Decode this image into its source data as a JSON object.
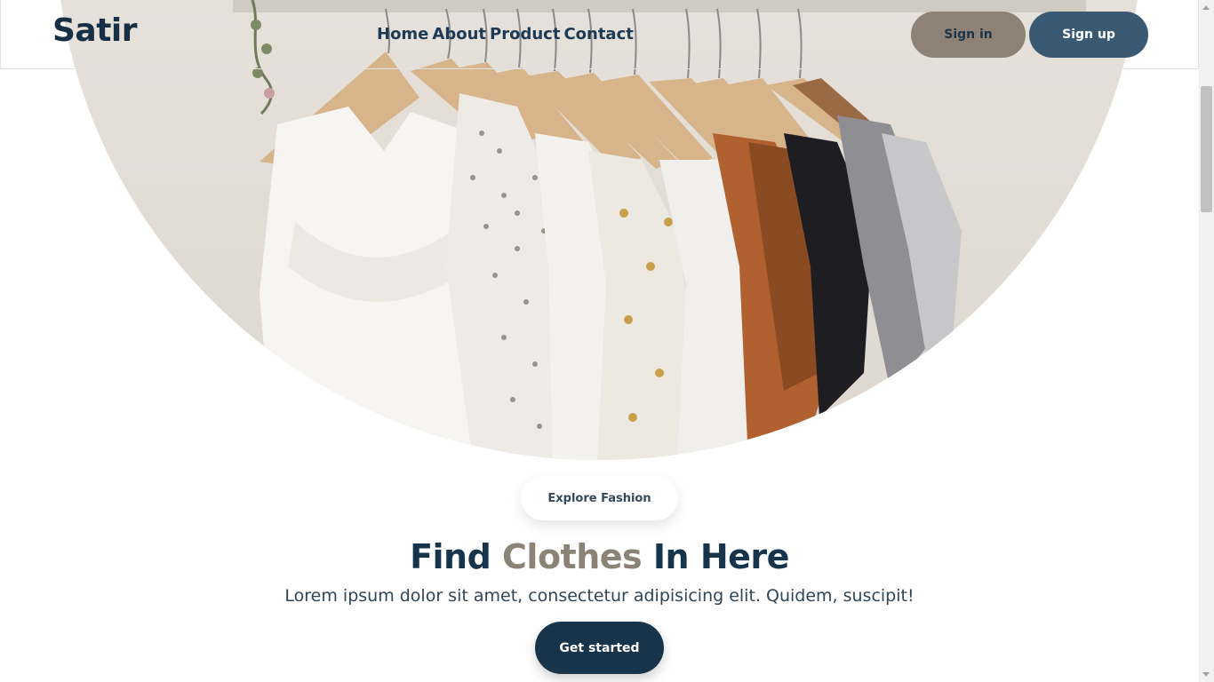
{
  "header": {
    "logo": "Satir",
    "nav": [
      "Home",
      "About",
      "Product",
      "Contact"
    ],
    "signin_label": "Sign in",
    "signup_label": "Sign up"
  },
  "hero": {
    "image_alt": "Clothes on hangers",
    "badge": "Explore Fashion",
    "title_part1": "Find ",
    "title_accent": "Clothes",
    "title_part2": " In Here",
    "subtitle": "Lorem ipsum dolor sit amet, consectetur adipisicing elit. Quidem, suscipit!",
    "cta_label": "Get started"
  },
  "colors": {
    "primary": "#17344a",
    "accent": "#8c8377",
    "signin_bg": "#8e8276",
    "signup_bg": "#3a5a74"
  }
}
